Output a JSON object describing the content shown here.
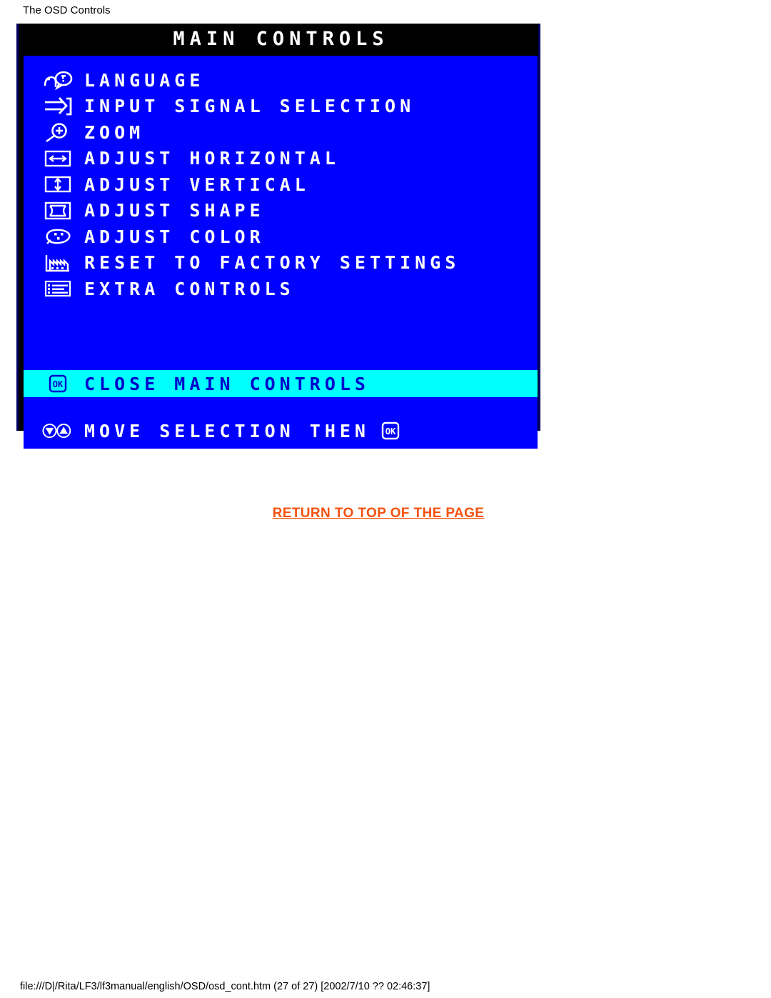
{
  "page": {
    "heading": "The OSD Controls",
    "return_link": "RETURN TO TOP OF THE PAGE",
    "footer_path": "file:///D|/Rita/LF3/lf3manual/english/OSD/osd_cont.htm (27 of 27) [2002/7/10 ?? 02:46:37]"
  },
  "colors": {
    "osd_background": "#0000ff",
    "osd_title_background": "#000000",
    "osd_text": "#ffffff",
    "highlight_background": "#00ffff",
    "highlight_text": "#0000cc",
    "link": "#f4510e",
    "page_background": "#ffffff"
  },
  "osd": {
    "title": "MAIN CONTROLS",
    "menu_items": [
      {
        "label": "LANGUAGE",
        "icon": "head-question-icon"
      },
      {
        "label": "INPUT SIGNAL SELECTION",
        "icon": "arrow-into-box-icon"
      },
      {
        "label": "ZOOM",
        "icon": "magnifier-plus-icon"
      },
      {
        "label": "ADJUST HORIZONTAL",
        "icon": "horizontal-arrows-icon"
      },
      {
        "label": "ADJUST VERTICAL",
        "icon": "vertical-arrows-icon"
      },
      {
        "label": "ADJUST SHAPE",
        "icon": "pincushion-frame-icon"
      },
      {
        "label": "ADJUST COLOR",
        "icon": "palette-icon"
      },
      {
        "label": "RESET TO FACTORY SETTINGS",
        "icon": "factory-icon"
      },
      {
        "label": "EXTRA CONTROLS",
        "icon": "list-lines-icon"
      }
    ],
    "selected_item": {
      "label": "CLOSE MAIN CONTROLS",
      "icon": "ok-button-icon"
    },
    "hint_bar": {
      "label": "MOVE SELECTION THEN",
      "left_icon": "down-up-arrows-icon",
      "right_icon": "ok-button-icon"
    }
  }
}
